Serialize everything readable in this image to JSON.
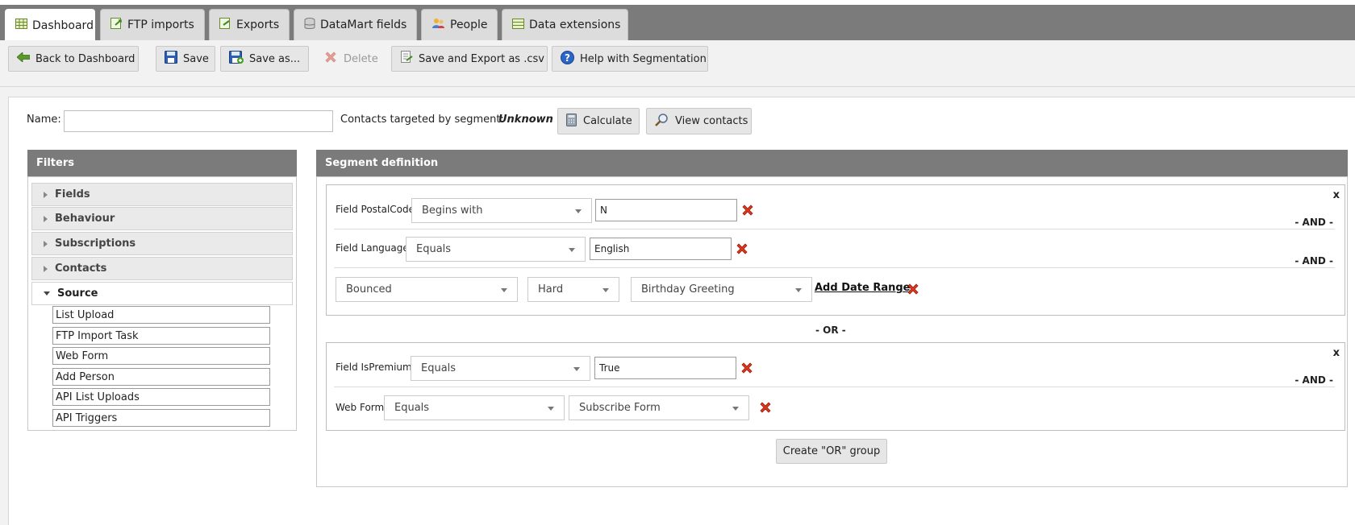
{
  "tabs": [
    {
      "label": "Dashboard",
      "icon": "grid-icon"
    },
    {
      "label": "FTP imports",
      "icon": "import-icon"
    },
    {
      "label": "Exports",
      "icon": "export-icon"
    },
    {
      "label": "DataMart fields",
      "icon": "database-icon"
    },
    {
      "label": "People",
      "icon": "people-icon"
    },
    {
      "label": "Data extensions",
      "icon": "table-icon"
    }
  ],
  "toolbar": {
    "back": "Back to Dashboard",
    "save": "Save",
    "save_as": "Save as...",
    "delete": "Delete",
    "save_export": "Save and Export as .csv",
    "help": "Help with Segmentation"
  },
  "segment": {
    "name_label": "Name:",
    "name_value": "",
    "targeted_label": "Contacts targeted by segment:",
    "targeted_value": "Unknown",
    "calculate": "Calculate",
    "view_contacts": "View contacts"
  },
  "filters": {
    "title": "Filters",
    "sections": [
      "Fields",
      "Behaviour",
      "Subscriptions",
      "Contacts",
      "Source"
    ],
    "source_items": [
      "List Upload",
      "FTP Import Task",
      "Web Form",
      "Add Person",
      "API List Uploads",
      "API Triggers"
    ]
  },
  "definition": {
    "title": "Segment definition",
    "close": "x",
    "and_label": "- AND -",
    "or_label": "- OR -",
    "group1": {
      "rule1": {
        "label": "Field PostalCode",
        "operator": "Begins with",
        "value": "N"
      },
      "rule2": {
        "label": "Field Language",
        "operator": "Equals",
        "value": "English"
      },
      "rule3": {
        "event": "Bounced",
        "type": "Hard",
        "campaign": "Birthday Greeting",
        "date_range": "Add Date Range"
      }
    },
    "group2": {
      "rule1": {
        "label": "Field IsPremium",
        "operator": "Equals",
        "value": "True"
      },
      "rule2": {
        "label": "Web Form",
        "operator": "Equals",
        "value": "Subscribe Form"
      }
    },
    "create_or": "Create \"OR\" group"
  }
}
